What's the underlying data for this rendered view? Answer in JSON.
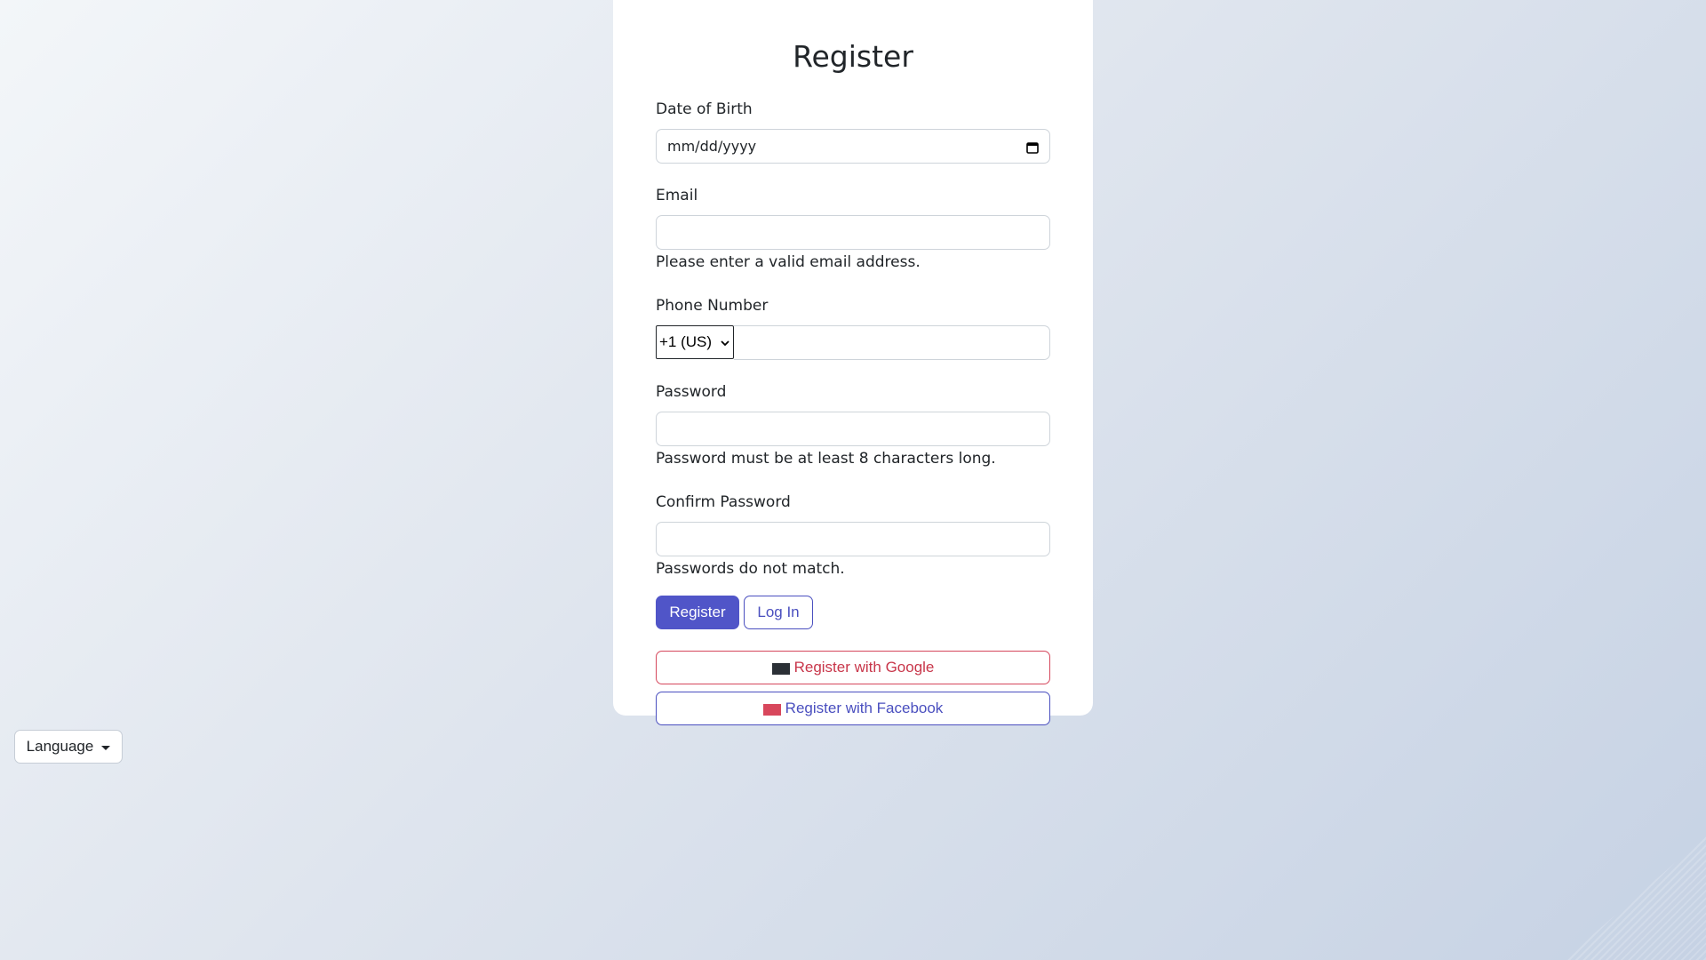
{
  "form": {
    "title": "Register",
    "dob": {
      "label": "Date of Birth",
      "placeholder": "mm/dd/yyyy"
    },
    "email": {
      "label": "Email",
      "value": "",
      "help": "Please enter a valid email address."
    },
    "phone": {
      "label": "Phone Number",
      "country_code": "+1 (US)",
      "value": ""
    },
    "password": {
      "label": "Password",
      "value": "",
      "help": "Password must be at least 8 characters long."
    },
    "confirm_password": {
      "label": "Confirm Password",
      "value": "",
      "help": "Passwords do not match."
    },
    "register_button": "Register",
    "login_button": "Log In",
    "google_button": "Register with Google",
    "facebook_button": "Register with Facebook"
  },
  "language": {
    "label": "Language"
  },
  "icons": {
    "calendar": "calendar-icon",
    "google": "google-logo-image",
    "facebook": "facebook-logo-image",
    "caret": "caret-down-icon"
  },
  "colors": {
    "primary": "#5055c8",
    "google": "#d5475c",
    "facebook": "#4a4fbf"
  }
}
